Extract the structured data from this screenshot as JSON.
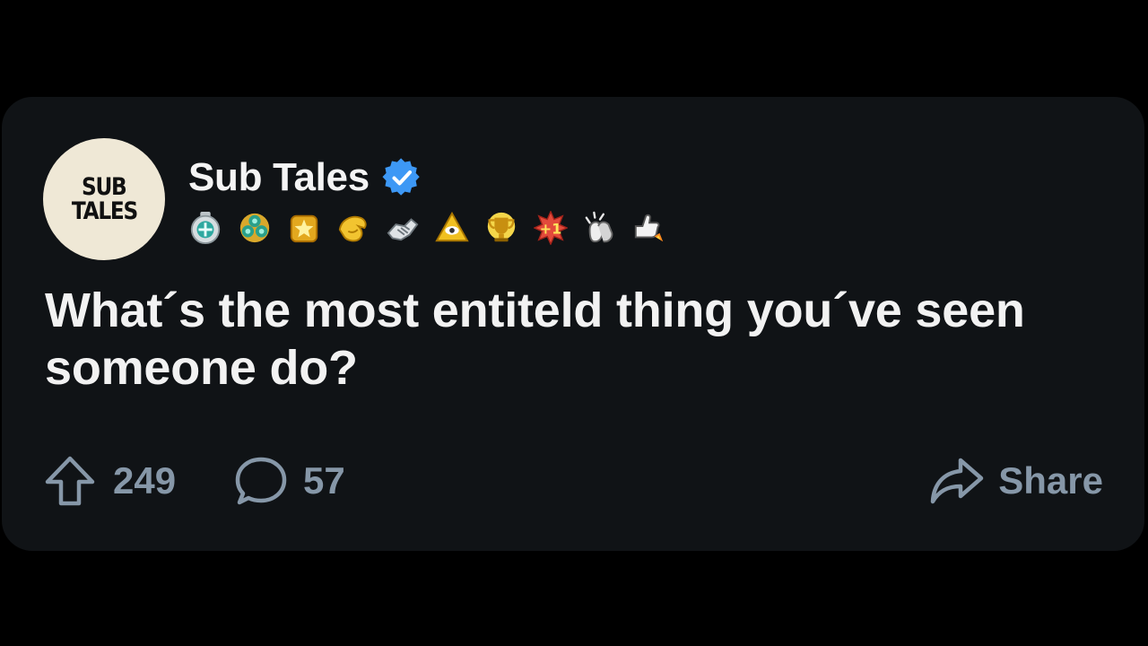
{
  "post": {
    "avatar": {
      "line1": "SUB",
      "line2": "TALES"
    },
    "author": "Sub Tales",
    "verified_icon": "verified-check-icon",
    "badges": [
      "silver-medal-award",
      "clover-award",
      "gold-star-award",
      "golden-hand-award",
      "handshake-award",
      "eye-pyramid-award",
      "trophy-award",
      "plus-one-award",
      "clapping-hands-award",
      "rocket-thumbs-up-award"
    ],
    "title": "What´s the most entiteld thing you´ve seen someone do?",
    "upvotes": "249",
    "comments": "57",
    "share_label": "Share"
  },
  "colors": {
    "background": "#000000",
    "card": "#101316",
    "text": "#f2f2f2",
    "muted": "#8697a8",
    "avatar_bg": "#efe8d6",
    "verified": "#3d98f5"
  }
}
